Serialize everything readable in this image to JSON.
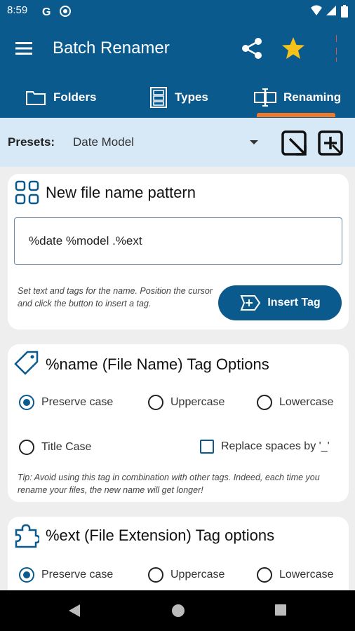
{
  "status_bar": {
    "time": "8:59",
    "icons": [
      "google-icon",
      "sync-icon",
      "wifi-icon",
      "signal-icon",
      "battery-icon"
    ]
  },
  "app_bar": {
    "title": "Batch Renamer",
    "icons": [
      "menu-icon",
      "share-icon",
      "star-icon"
    ]
  },
  "tabs": [
    {
      "label": "Folders",
      "icon": "folder-icon"
    },
    {
      "label": "Types",
      "icon": "file-cabinet-icon"
    },
    {
      "label": "Renaming",
      "icon": "rename-icon",
      "selected": true
    }
  ],
  "presets": {
    "label": "Presets:",
    "value": "Date Model"
  },
  "pattern_card": {
    "title": "New file name pattern",
    "input_value": "%date %model .%ext",
    "help_text": "Set text and tags for the name. Position the cursor and click the button to insert a tag.",
    "insert_button": "Insert Tag"
  },
  "name_tag_card": {
    "title": "%name (File Name) Tag Options",
    "options": {
      "preserve": "Preserve case",
      "upper": "Uppercase",
      "lower": "Lowercase",
      "title": "Title Case"
    },
    "selected": "Preserve case",
    "replace_spaces_label": "Replace spaces by '_'",
    "replace_spaces_checked": false,
    "tip": "Tip: Avoid using this tag in combination with other tags. Indeed, each time you rename your files, the new name will get longer!"
  },
  "ext_tag_card": {
    "title": "%ext (File Extension) Tag options",
    "options": {
      "preserve": "Preserve case",
      "upper": "Uppercase",
      "lower": "Lowercase"
    },
    "selected": "Preserve case"
  },
  "colors": {
    "primary": "#0b5a8e",
    "accent": "#f07a2a",
    "star": "#f4c21a",
    "presets_bg": "#d7e9f7"
  }
}
